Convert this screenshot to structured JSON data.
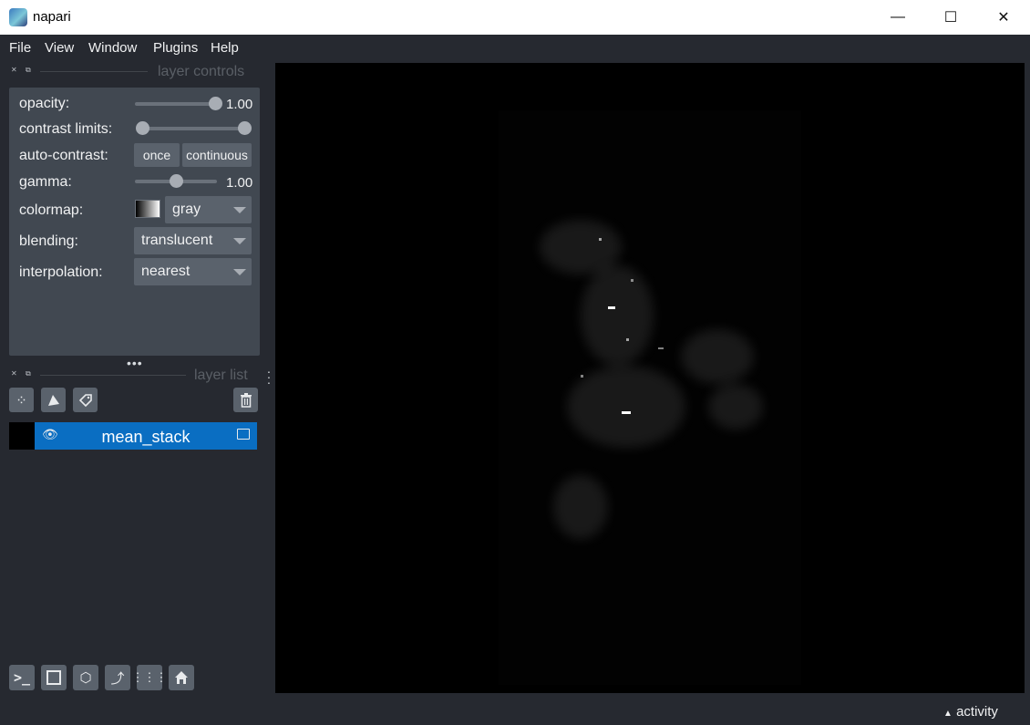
{
  "window": {
    "title": "napari",
    "minimize": "—",
    "maximize": "☐",
    "close": "✕"
  },
  "menu": {
    "file": "File",
    "view": "View",
    "window": "Window",
    "plugins": "Plugins",
    "help": "Help"
  },
  "layer_controls": {
    "title": "layer controls",
    "opacity_label": "opacity:",
    "opacity_value": "1.00",
    "opacity_level": 1.0,
    "contrast_label": "contrast limits:",
    "contrast_range": [
      0.0,
      1.0
    ],
    "autocontrast_label": "auto-contrast:",
    "once_button": "once",
    "continuous_button": "continuous",
    "gamma_label": "gamma:",
    "gamma_value": "1.00",
    "gamma_level": 0.5,
    "colormap_label": "colormap:",
    "colormap_value": "gray",
    "blending_label": "blending:",
    "blending_value": "translucent",
    "interpolation_label": "interpolation:",
    "interpolation_value": "nearest",
    "splitter": "•••"
  },
  "layer_list": {
    "title": "layer list",
    "layers": [
      {
        "name": "mean_stack",
        "visible": true,
        "type_icon": "image-icon"
      }
    ]
  },
  "status": {
    "activity": "activity"
  },
  "colors": {
    "background": "#262930",
    "panel": "#414851",
    "selected_layer": "#0a6ec2",
    "canvas": "#000000"
  }
}
